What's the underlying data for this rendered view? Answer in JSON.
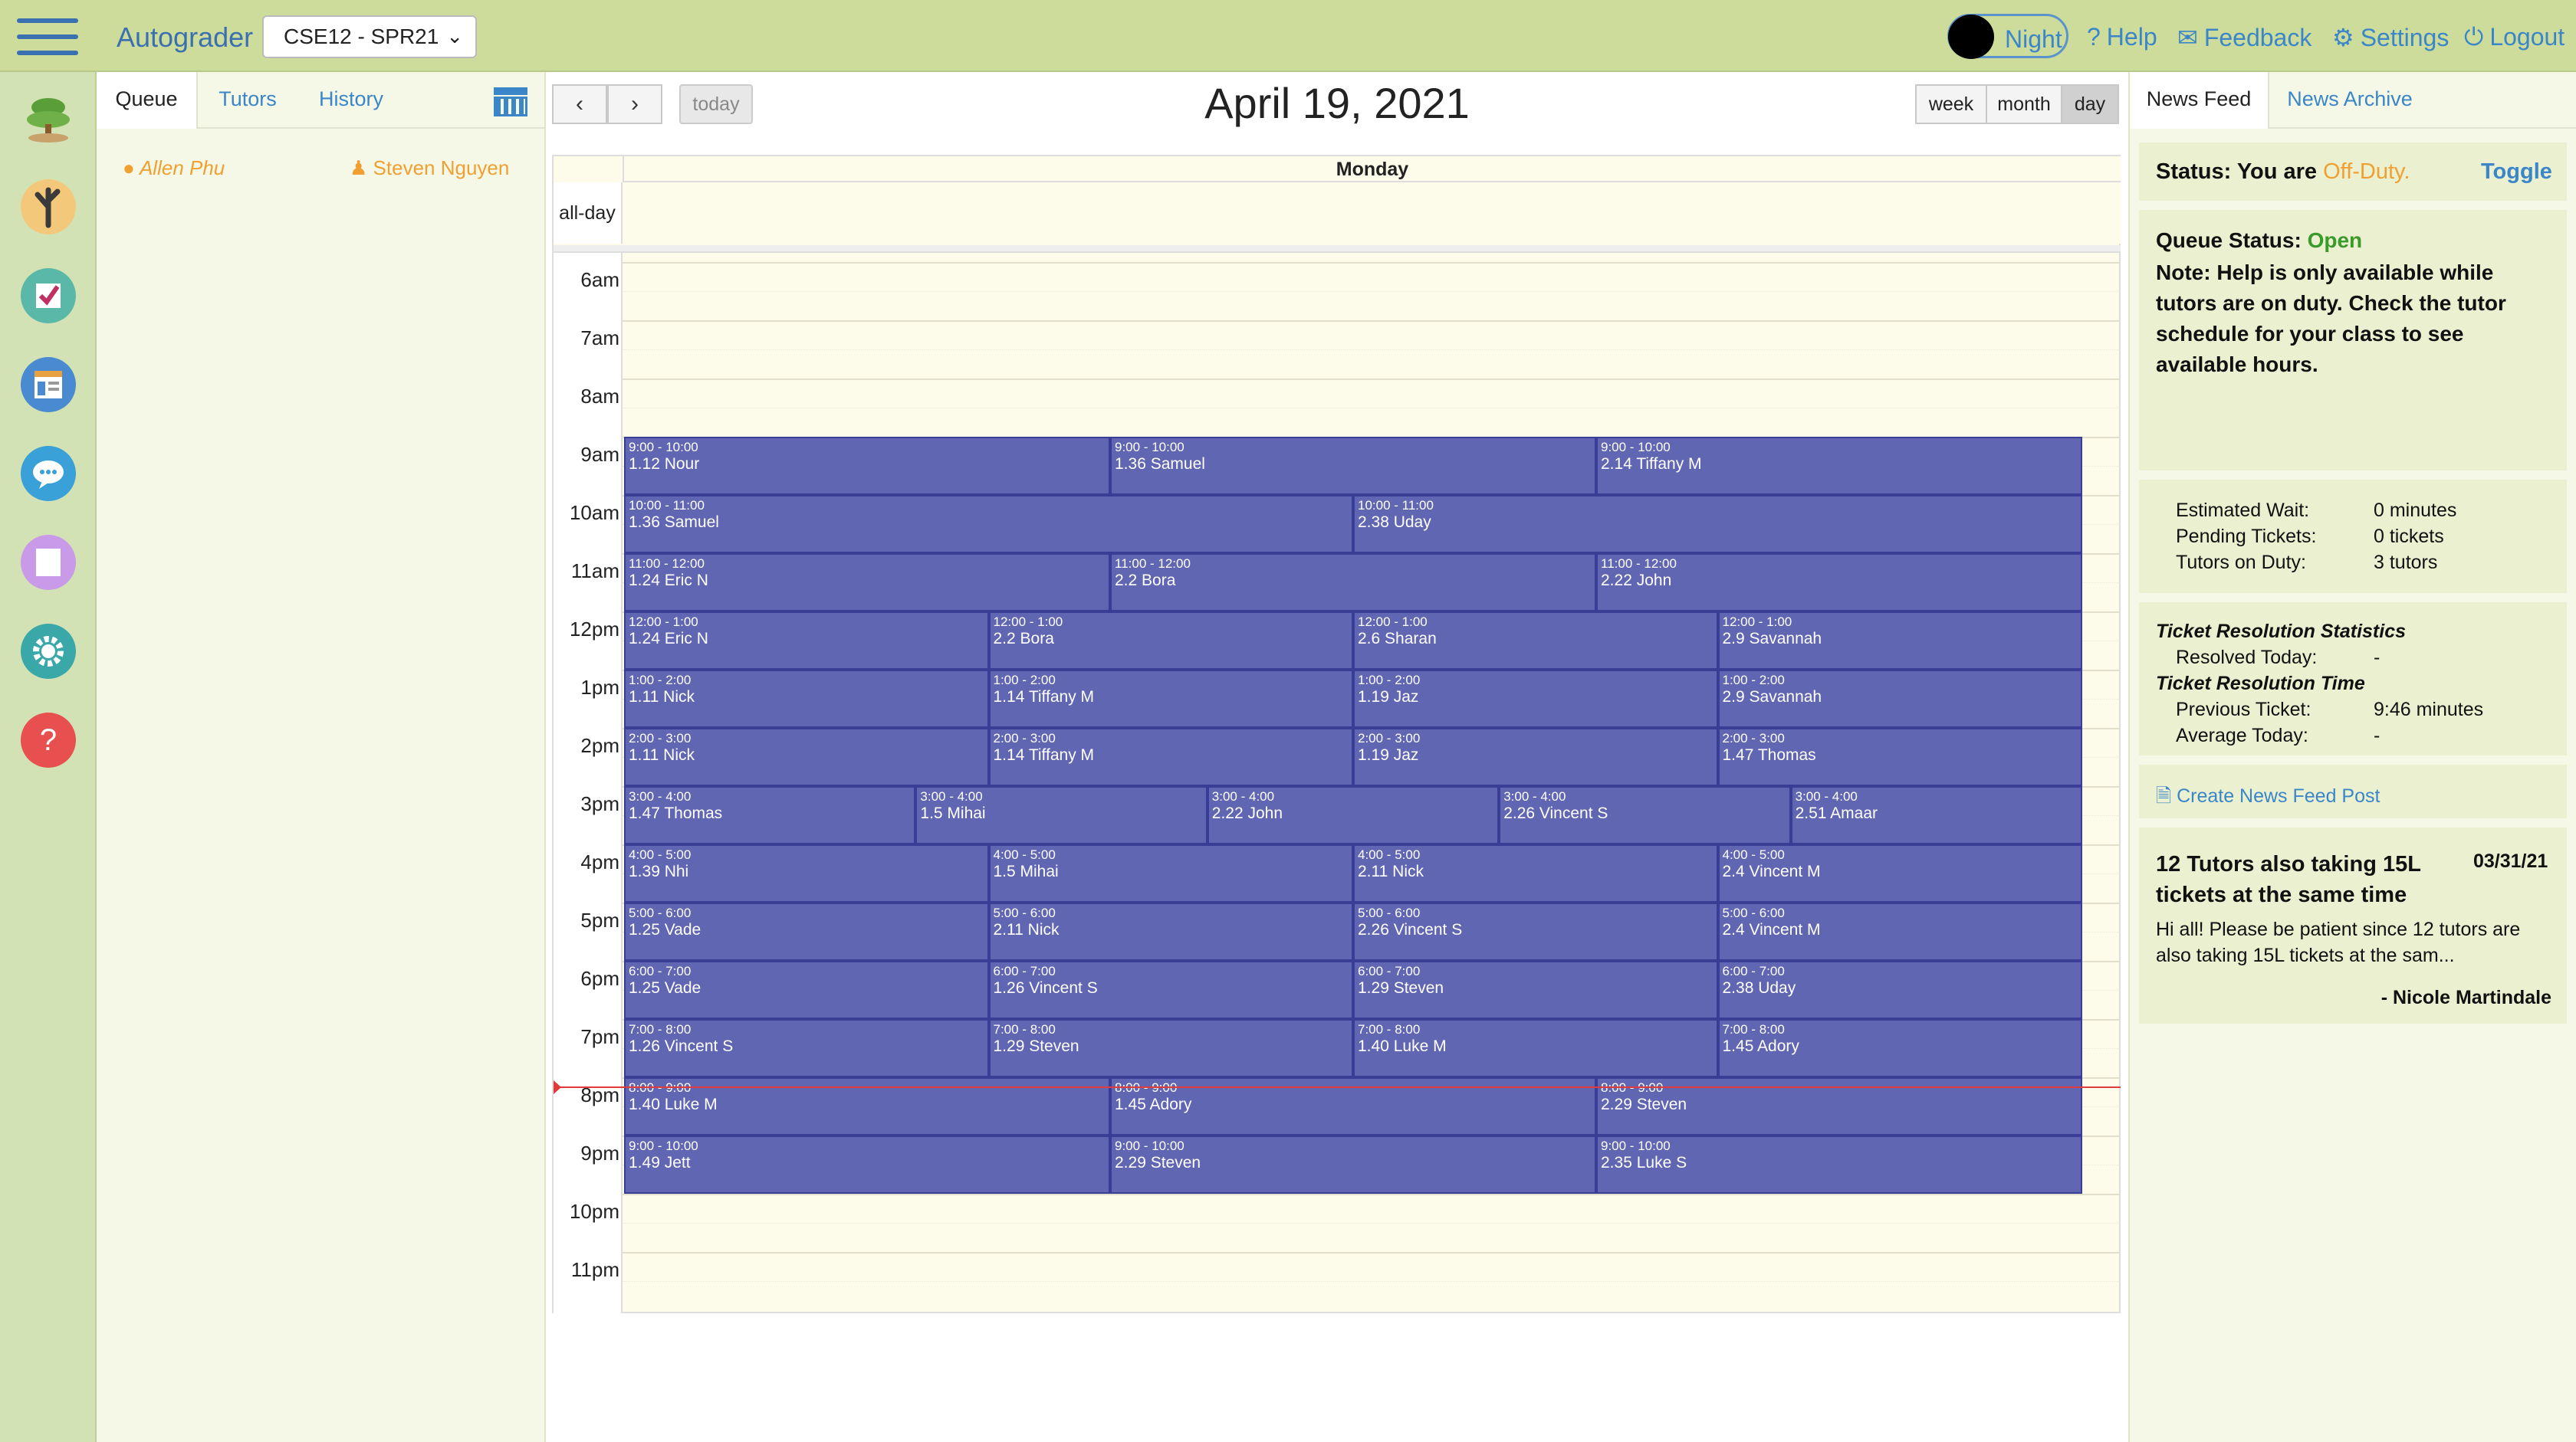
{
  "app": {
    "title": "Autograder",
    "course": "CSE12 - SPR21"
  },
  "topnav": {
    "night_label": "Night",
    "help": "Help",
    "feedback": "Feedback",
    "settings": "Settings",
    "logout": "Logout"
  },
  "queue_panel": {
    "tabs": [
      "Queue",
      "Tutors",
      "History"
    ],
    "people": [
      {
        "name": "Allen Phu",
        "icon": "chat-bubble-icon"
      },
      {
        "name": "Steven Nguyen",
        "icon": "person-icon"
      }
    ]
  },
  "calendar": {
    "today_label": "today",
    "title": "April 19, 2021",
    "views": [
      "week",
      "month",
      "day"
    ],
    "active_view": "day",
    "day_header": "Monday",
    "allday_label": "all-day",
    "hours": [
      "6am",
      "7am",
      "8am",
      "9am",
      "10am",
      "11am",
      "12pm",
      "1pm",
      "2pm",
      "3pm",
      "4pm",
      "5pm",
      "6pm",
      "7pm",
      "8pm",
      "9pm",
      "10pm",
      "11pm"
    ],
    "events": [
      {
        "start": 9,
        "col": 0,
        "cols": 3,
        "time": "9:00 - 10:00",
        "title": "1.12 Nour"
      },
      {
        "start": 9,
        "col": 1,
        "cols": 3,
        "time": "9:00 - 10:00",
        "title": "1.36 Samuel"
      },
      {
        "start": 9,
        "col": 2,
        "cols": 3,
        "time": "9:00 - 10:00",
        "title": "2.14 Tiffany M"
      },
      {
        "start": 10,
        "col": 0,
        "cols": 2,
        "time": "10:00 - 11:00",
        "title": "1.36 Samuel"
      },
      {
        "start": 10,
        "col": 1,
        "cols": 2,
        "time": "10:00 - 11:00",
        "title": "2.38 Uday"
      },
      {
        "start": 11,
        "col": 0,
        "cols": 3,
        "time": "11:00 - 12:00",
        "title": "1.24 Eric N"
      },
      {
        "start": 11,
        "col": 1,
        "cols": 3,
        "time": "11:00 - 12:00",
        "title": "2.2 Bora"
      },
      {
        "start": 11,
        "col": 2,
        "cols": 3,
        "time": "11:00 - 12:00",
        "title": "2.22 John"
      },
      {
        "start": 12,
        "col": 0,
        "cols": 4,
        "time": "12:00 - 1:00",
        "title": "1.24 Eric N"
      },
      {
        "start": 12,
        "col": 1,
        "cols": 4,
        "time": "12:00 - 1:00",
        "title": "2.2 Bora"
      },
      {
        "start": 12,
        "col": 2,
        "cols": 4,
        "time": "12:00 - 1:00",
        "title": "2.6 Sharan"
      },
      {
        "start": 12,
        "col": 3,
        "cols": 4,
        "time": "12:00 - 1:00",
        "title": "2.9 Savannah"
      },
      {
        "start": 13,
        "col": 0,
        "cols": 4,
        "time": "1:00 - 2:00",
        "title": "1.11 Nick"
      },
      {
        "start": 13,
        "col": 1,
        "cols": 4,
        "time": "1:00 - 2:00",
        "title": "1.14 Tiffany M"
      },
      {
        "start": 13,
        "col": 2,
        "cols": 4,
        "time": "1:00 - 2:00",
        "title": "1.19 Jaz"
      },
      {
        "start": 13,
        "col": 3,
        "cols": 4,
        "time": "1:00 - 2:00",
        "title": "2.9 Savannah"
      },
      {
        "start": 14,
        "col": 0,
        "cols": 4,
        "time": "2:00 - 3:00",
        "title": "1.11 Nick"
      },
      {
        "start": 14,
        "col": 1,
        "cols": 4,
        "time": "2:00 - 3:00",
        "title": "1.14 Tiffany M"
      },
      {
        "start": 14,
        "col": 2,
        "cols": 4,
        "time": "2:00 - 3:00",
        "title": "1.19 Jaz"
      },
      {
        "start": 14,
        "col": 3,
        "cols": 4,
        "time": "2:00 - 3:00",
        "title": "1.47 Thomas"
      },
      {
        "start": 15,
        "col": 0,
        "cols": 5,
        "time": "3:00 - 4:00",
        "title": "1.47 Thomas"
      },
      {
        "start": 15,
        "col": 1,
        "cols": 5,
        "time": "3:00 - 4:00",
        "title": "1.5 Mihai"
      },
      {
        "start": 15,
        "col": 2,
        "cols": 5,
        "time": "3:00 - 4:00",
        "title": "2.22 John"
      },
      {
        "start": 15,
        "col": 3,
        "cols": 5,
        "time": "3:00 - 4:00",
        "title": "2.26 Vincent S"
      },
      {
        "start": 15,
        "col": 4,
        "cols": 5,
        "time": "3:00 - 4:00",
        "title": "2.51 Amaar"
      },
      {
        "start": 16,
        "col": 0,
        "cols": 4,
        "time": "4:00 - 5:00",
        "title": "1.39 Nhi"
      },
      {
        "start": 16,
        "col": 1,
        "cols": 4,
        "time": "4:00 - 5:00",
        "title": "1.5 Mihai"
      },
      {
        "start": 16,
        "col": 2,
        "cols": 4,
        "time": "4:00 - 5:00",
        "title": "2.11 Nick"
      },
      {
        "start": 16,
        "col": 3,
        "cols": 4,
        "time": "4:00 - 5:00",
        "title": "2.4 Vincent M"
      },
      {
        "start": 17,
        "col": 0,
        "cols": 4,
        "time": "5:00 - 6:00",
        "title": "1.25 Vade"
      },
      {
        "start": 17,
        "col": 1,
        "cols": 4,
        "time": "5:00 - 6:00",
        "title": "2.11 Nick"
      },
      {
        "start": 17,
        "col": 2,
        "cols": 4,
        "time": "5:00 - 6:00",
        "title": "2.26 Vincent S"
      },
      {
        "start": 17,
        "col": 3,
        "cols": 4,
        "time": "5:00 - 6:00",
        "title": "2.4 Vincent M"
      },
      {
        "start": 18,
        "col": 0,
        "cols": 4,
        "time": "6:00 - 7:00",
        "title": "1.25 Vade"
      },
      {
        "start": 18,
        "col": 1,
        "cols": 4,
        "time": "6:00 - 7:00",
        "title": "1.26 Vincent S"
      },
      {
        "start": 18,
        "col": 2,
        "cols": 4,
        "time": "6:00 - 7:00",
        "title": "1.29 Steven"
      },
      {
        "start": 18,
        "col": 3,
        "cols": 4,
        "time": "6:00 - 7:00",
        "title": "2.38 Uday"
      },
      {
        "start": 19,
        "col": 0,
        "cols": 4,
        "time": "7:00 - 8:00",
        "title": "1.26 Vincent S"
      },
      {
        "start": 19,
        "col": 1,
        "cols": 4,
        "time": "7:00 - 8:00",
        "title": "1.29 Steven"
      },
      {
        "start": 19,
        "col": 2,
        "cols": 4,
        "time": "7:00 - 8:00",
        "title": "1.40 Luke M"
      },
      {
        "start": 19,
        "col": 3,
        "cols": 4,
        "time": "7:00 - 8:00",
        "title": "1.45 Adory"
      },
      {
        "start": 20,
        "col": 0,
        "cols": 3,
        "time": "8:00 - 9:00",
        "title": "1.40 Luke M"
      },
      {
        "start": 20,
        "col": 1,
        "cols": 3,
        "time": "8:00 - 9:00",
        "title": "1.45 Adory"
      },
      {
        "start": 20,
        "col": 2,
        "cols": 3,
        "time": "8:00 - 9:00",
        "title": "2.29 Steven"
      },
      {
        "start": 21,
        "col": 0,
        "cols": 3,
        "time": "9:00 - 10:00",
        "title": "1.49 Jett"
      },
      {
        "start": 21,
        "col": 1,
        "cols": 3,
        "time": "9:00 - 10:00",
        "title": "2.29 Steven"
      },
      {
        "start": 21,
        "col": 2,
        "cols": 3,
        "time": "9:00 - 10:00",
        "title": "2.35 Luke S"
      }
    ]
  },
  "news": {
    "tabs": [
      "News Feed",
      "News Archive"
    ],
    "status_label": "Status: You are ",
    "status_value": "Off-Duty.",
    "toggle": "Toggle",
    "queue_status_label": "Queue Status: ",
    "queue_status_value": "Open",
    "note": "Note: Help is only available while tutors are on duty. Check the tutor schedule for your class to see available hours.",
    "stats": [
      {
        "label": "Estimated Wait:",
        "value": "0 minutes"
      },
      {
        "label": "Pending Tickets:",
        "value": "0 tickets"
      },
      {
        "label": "Tutors on Duty:",
        "value": "3 tutors"
      }
    ],
    "resolution_stats_title": "Ticket Resolution Statistics",
    "resolved_today_label": "Resolved Today:",
    "resolved_today_value": "-",
    "resolution_time_title": "Ticket Resolution Time",
    "previous_ticket_label": "Previous Ticket:",
    "previous_ticket_value": "9:46 minutes",
    "average_today_label": "Average Today:",
    "average_today_value": "-",
    "create_post": "Create News Feed Post",
    "post": {
      "title": "12 Tutors also taking 15L tickets at the same time",
      "date": "03/31/21",
      "body": "Hi all! Please be patient since 12 tutors are also taking 15L tickets at the sam...",
      "author": "- Nicole Martindale"
    }
  },
  "colors": {
    "topbar": "#cddc9a",
    "event": "#6166b3",
    "link": "#3a86c8",
    "off_duty": "#f0a030",
    "open": "#3a9a2a"
  }
}
